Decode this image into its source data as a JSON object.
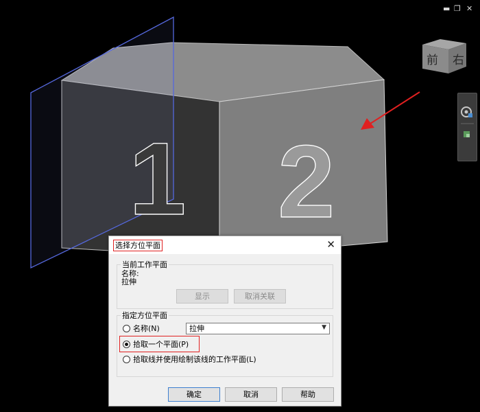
{
  "window_controls": {
    "minimize": "▬",
    "restore": "❐",
    "close": "✕"
  },
  "viewcube": {
    "front_label": "前",
    "right_label": "右"
  },
  "scene": {
    "number_left": "1",
    "number_right": "2"
  },
  "dialog": {
    "title": "选择方位平面",
    "close_glyph": "✕",
    "current_plane": {
      "legend": "当前工作平面",
      "name_label": "名称:",
      "name_value": "拉伸",
      "show_button": "显示",
      "disassociate_button": "取消关联"
    },
    "specify_plane": {
      "legend": "指定方位平面",
      "option_name": "名称(N)",
      "name_select_value": "拉伸",
      "option_pick_plane": "拾取一个平面(P)",
      "option_pick_line": "拾取线并使用绘制该线的工作平面(L)",
      "selected": "pick_plane"
    },
    "ok_button": "确定",
    "cancel_button": "取消",
    "help_button": "帮助"
  },
  "colors": {
    "annotation_red": "#e02020",
    "plane_blue": "#4f66d6",
    "background": "#000000"
  }
}
